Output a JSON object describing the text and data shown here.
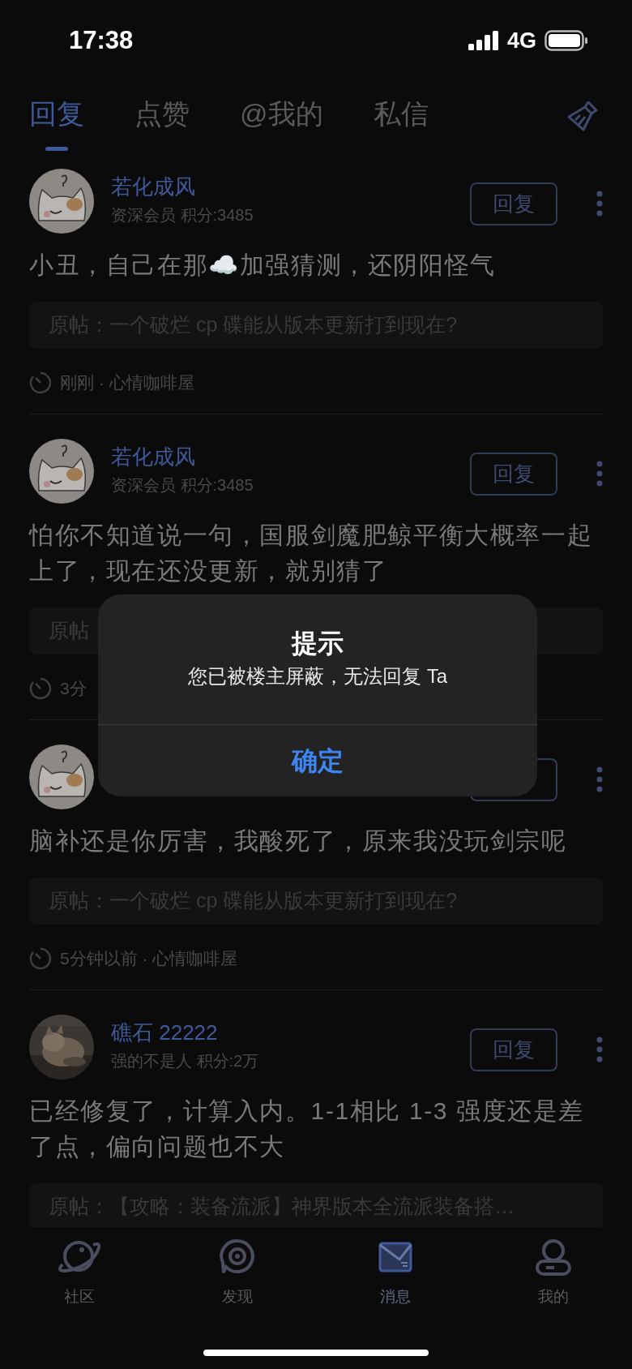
{
  "status_bar": {
    "time": "17:38",
    "network": "4G"
  },
  "tabs": [
    {
      "label": "回复",
      "selected": true
    },
    {
      "label": "点赞",
      "selected": false
    },
    {
      "label": "@我的",
      "selected": false
    },
    {
      "label": "私信",
      "selected": false
    }
  ],
  "posts": [
    {
      "avatar": {
        "kind": "drawing"
      },
      "name": "若化成风",
      "meta": "资深会员 积分:3485",
      "reply_label": "回复",
      "content": "小丑，自己在那☁️加强猜测，还阴阳怪气",
      "quote": "原帖：一个破烂 cp 碟能从版本更新打到现在?",
      "time_line": "刚刚 · 心情咖啡屋"
    },
    {
      "avatar": {
        "kind": "drawing"
      },
      "name": "若化成风",
      "meta": "资深会员 积分:3485",
      "reply_label": "回复",
      "content": "怕你不知道说一句，国服剑魔肥鲸平衡大概率一起上了，现在还没更新，就别猜了",
      "quote": "原帖",
      "time_line": "3分"
    },
    {
      "avatar": {
        "kind": "drawing"
      },
      "content": "脑补还是你厉害，我酸死了，原来我没玩剑宗呢",
      "quote": "原帖：一个破烂 cp 碟能从版本更新打到现在?",
      "time_line": "5分钟以前 · 心情咖啡屋"
    },
    {
      "name": "礁石 22222",
      "meta": "强的不是人 积分:2万",
      "reply_label": "回复",
      "content": "已经修复了，计算入内。1-1相比 1-3 强度还是差了点，偏向问题也不大",
      "quote": "原帖：【攻略：装备流派】神界版本全流派装备搭…"
    }
  ],
  "dialog": {
    "title": "提示",
    "message": "您已被楼主屏蔽，无法回复 Ta",
    "button": "确定"
  },
  "bottom_nav": [
    {
      "kind": "planet",
      "label": "社区",
      "selected": false
    },
    {
      "kind": "discover",
      "label": "发现",
      "selected": false
    },
    {
      "kind": "message",
      "label": "消息",
      "selected": true
    },
    {
      "kind": "profile",
      "label": "我的",
      "selected": false
    }
  ]
}
